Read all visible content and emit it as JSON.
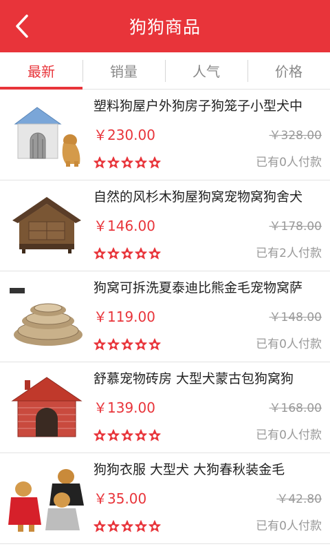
{
  "header": {
    "title": "狗狗商品",
    "back_icon": "chevron-left-icon",
    "background": "#e8343a"
  },
  "tabs": [
    {
      "label": "最新",
      "active": true
    },
    {
      "label": "销量",
      "active": false
    },
    {
      "label": "人气",
      "active": false
    },
    {
      "label": "价格",
      "active": false
    }
  ],
  "products": [
    {
      "title": "塑料狗屋户外狗房子狗笼子小型犬中",
      "price": "￥230.00",
      "old_price": "￥328.00",
      "rating": 5,
      "sold": "已有0人付款",
      "image": "plastic-dog-house"
    },
    {
      "title": "自然的风杉木狗屋狗窝宠物窝狗舍犬",
      "price": "￥146.00",
      "old_price": "￥178.00",
      "rating": 5,
      "sold": "已有2人付款",
      "image": "wooden-dog-house"
    },
    {
      "title": "狗窝可拆洗夏泰迪比熊金毛宠物窝萨",
      "price": "￥119.00",
      "old_price": "￥148.00",
      "rating": 5,
      "sold": "已有0人付款",
      "image": "dog-bed-set"
    },
    {
      "title": "舒慕宠物砖房 大型犬蒙古包狗窝狗",
      "price": "￥139.00",
      "old_price": "￥168.00",
      "rating": 5,
      "sold": "已有0人付款",
      "image": "brick-dog-house"
    },
    {
      "title": "狗狗衣服 大型犬 大狗春秋装金毛",
      "price": "￥35.00",
      "old_price": "￥42.80",
      "rating": 5,
      "sold": "已有0人付款",
      "image": "dog-clothes"
    }
  ],
  "colors": {
    "accent": "#e8343a",
    "star": "#e8343a",
    "muted": "#999999"
  }
}
